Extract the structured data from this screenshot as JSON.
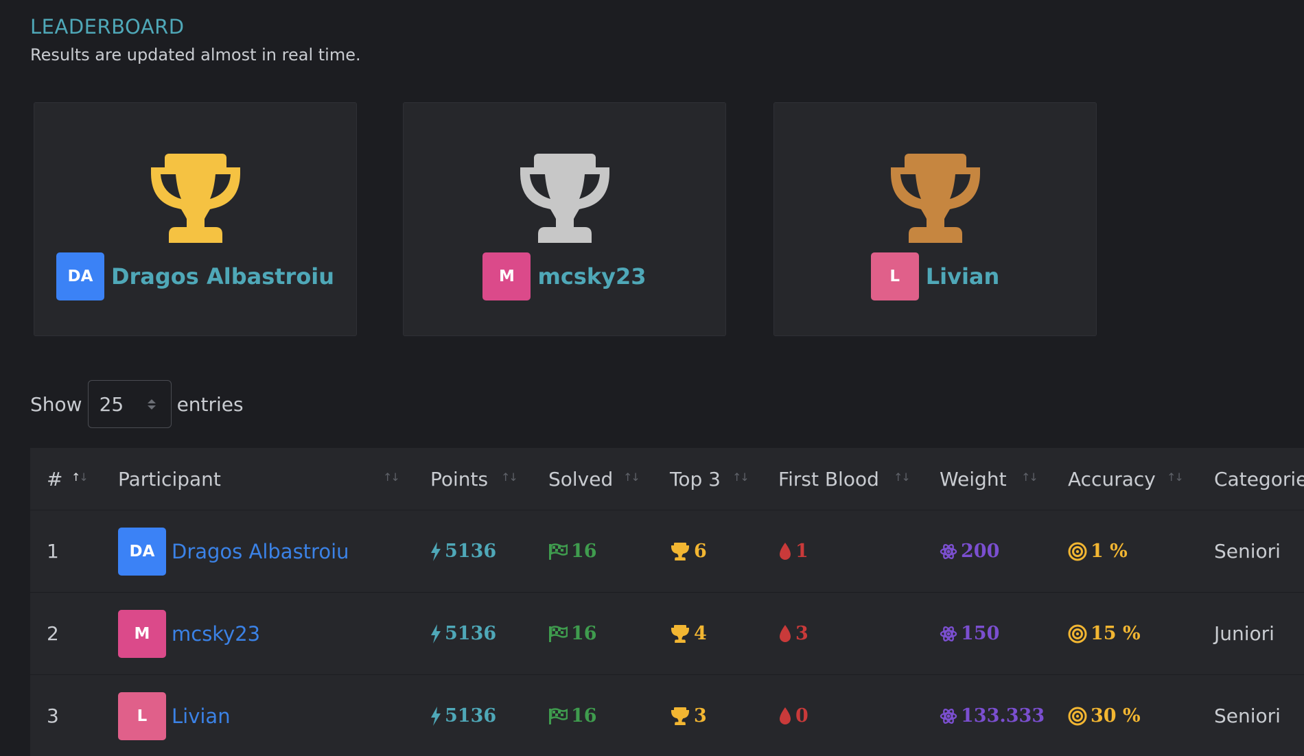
{
  "header": {
    "title": "LEADERBOARD",
    "subtitle": "Results are updated almost in real time."
  },
  "podium": [
    {
      "place": 1,
      "initials": "DA",
      "name": "Dragos Albastroiu",
      "trophy_color": "#f5c242",
      "avatar_color": "#3b82f6"
    },
    {
      "place": 2,
      "initials": "M",
      "name": "mcsky23",
      "trophy_color": "#c7c7c7",
      "avatar_color": "#db4a8a"
    },
    {
      "place": 3,
      "initials": "L",
      "name": "Livian",
      "trophy_color": "#c68640",
      "avatar_color": "#e0608a"
    }
  ],
  "entries": {
    "show_label": "Show",
    "value": "25",
    "suffix_label": "entries"
  },
  "table": {
    "columns": [
      "#",
      "Participant",
      "Points",
      "Solved",
      "Top 3",
      "First Blood",
      "Weight",
      "Accuracy",
      "Categorie"
    ],
    "rows": [
      {
        "rank": "1",
        "initials": "DA",
        "avatar_color": "#3b82f6",
        "name": "Dragos Albastroiu",
        "points": "5136",
        "solved": "16",
        "top3": "6",
        "first_blood": "1",
        "weight": "200",
        "accuracy": "1 %",
        "category": "Seniori"
      },
      {
        "rank": "2",
        "initials": "M",
        "avatar_color": "#db4a8a",
        "name": "mcsky23",
        "points": "5136",
        "solved": "16",
        "top3": "4",
        "first_blood": "3",
        "weight": "150",
        "accuracy": "15 %",
        "category": "Juniori"
      },
      {
        "rank": "3",
        "initials": "L",
        "avatar_color": "#e0608a",
        "name": "Livian",
        "points": "5136",
        "solved": "16",
        "top3": "3",
        "first_blood": "0",
        "weight": "133.333",
        "accuracy": "30 %",
        "category": "Seniori"
      }
    ]
  },
  "icons": {
    "points": "bolt-icon",
    "solved": "checkered-flag-icon",
    "top3": "trophy-icon",
    "first_blood": "blood-drop-icon",
    "weight": "atom-icon",
    "accuracy": "target-icon"
  },
  "colors": {
    "accent_teal": "#4fa8b8",
    "link_blue": "#3b82e6",
    "solved_green": "#3f9c4e",
    "gold": "#f2b632",
    "blood_red": "#c93a3a",
    "weight_purple": "#7b4fd0"
  }
}
